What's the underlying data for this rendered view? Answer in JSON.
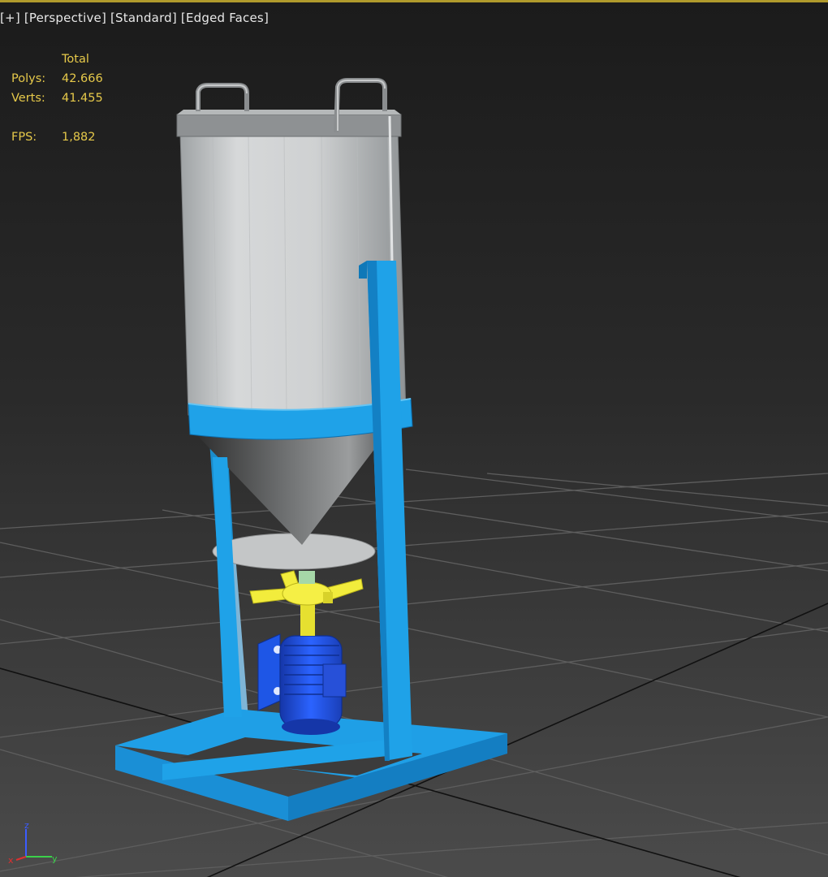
{
  "viewport": {
    "menu": {
      "plus": "[+]",
      "view": "[Perspective]",
      "shading": "[Standard]",
      "mode": "[Edged Faces]"
    },
    "stats": {
      "header": "Total",
      "polys_label": "Polys:",
      "polys_value": "42.666",
      "verts_label": "Verts:",
      "verts_value": "41.455",
      "fps_label": "FPS:",
      "fps_value": "1,882"
    },
    "axis": {
      "z": "z",
      "x": "x",
      "y": "y"
    },
    "colors": {
      "frame_selected": "#1fa2e8",
      "tank": "#c9cccd",
      "impeller": "#f0ea3a",
      "motor": "#1e56e6",
      "stat_text": "#e6c94a",
      "border_active": "#b09a2c"
    }
  }
}
